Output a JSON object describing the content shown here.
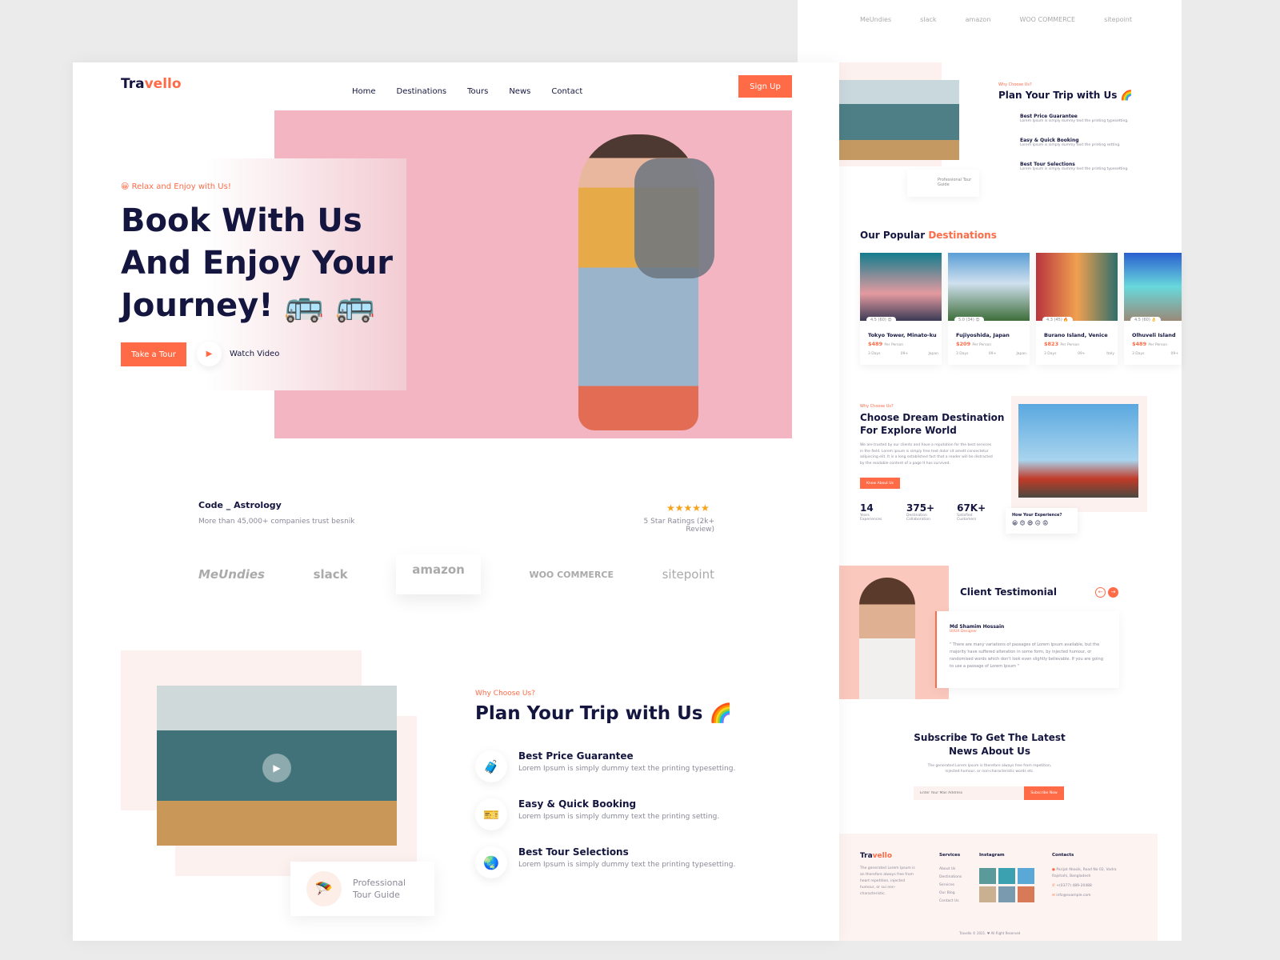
{
  "colors": {
    "accent": "#ff6b47",
    "navy": "#14163f",
    "pink": "#f2b8c2",
    "soft": "#fdf1ef"
  },
  "header": {
    "logo_a": "Tra",
    "logo_b": "vello",
    "nav": [
      "Home",
      "Destinations",
      "Tours",
      "News",
      "Contact"
    ],
    "signup": "Sign Up"
  },
  "hero": {
    "eyebrow": "😀 Relax and Enjoy with Us!",
    "title_l1": "Book With Us",
    "title_l2": "And Enjoy Your",
    "title_l3": "Journey! 🚌 🚌",
    "cta": "Take a Tour",
    "video": "Watch Video"
  },
  "trust": {
    "company": "Code _ Astrology",
    "sub": "More than 45,000+ companies trust besnik",
    "stars": "★★★★★",
    "rating": "5 Star Ratings (2k+ Review)",
    "rating_value": 5
  },
  "brands": [
    "MeUndies",
    "slack",
    "amazon",
    "WOO COMMERCE",
    "sitepoint"
  ],
  "plan": {
    "eyebrow": "Why Choose Us?",
    "title": "Plan Your Trip with Us 🌈",
    "guide": "Professional Tour Guide",
    "features": [
      {
        "icon": "luggage-icon",
        "glyph": "🧳",
        "title": "Best Price Guarantee",
        "desc": "Lorem Ipsum is simply dummy text the printing typesetting."
      },
      {
        "icon": "ticket-icon",
        "glyph": "🎫",
        "title": "Easy & Quick Booking",
        "desc": "Lorem Ipsum is simply dummy text the printing setting."
      },
      {
        "icon": "globe-icon",
        "glyph": "🌏",
        "title": "Best Tour Selections",
        "desc": "Lorem Ipsum is simply dummy text the printing typesetting."
      }
    ]
  },
  "popular": {
    "title_a": "Our Popular ",
    "title_b": "Destinations",
    "cards": [
      {
        "name": "Tokyo Tower, Minato-ku",
        "price": "$489",
        "per": "Per Person",
        "rating": "4.5 (60) 😍",
        "days": "3 Days",
        "people": "09+",
        "place": "Japan"
      },
      {
        "name": "Fujiyoshida, Japan",
        "price": "$209",
        "per": "Per Person",
        "rating": "5.0 (34) 😍",
        "days": "3 Days",
        "people": "09+",
        "place": "Japan"
      },
      {
        "name": "Burano Island, Venice",
        "price": "$823",
        "per": "Per Person",
        "rating": "4.3 (45) 🔥",
        "days": "3 Days",
        "people": "09+",
        "place": "Italy"
      },
      {
        "name": "Olhuveli Island",
        "price": "$489",
        "per": "Per Person",
        "rating": "4.5 (60) 👌",
        "days": "3 Days",
        "people": "09+",
        "place": ""
      }
    ]
  },
  "dream": {
    "eyebrow": "Why Choose Us?",
    "title_l1": "Choose Dream Destination",
    "title_l2": "For Explore World",
    "body": "We are trusted by our clients and have a reputation for the best services in the field. Lorem ipsum is simply free text dolor sit amett consectetur adipiscing elit. It is a long established fact that a reader will be distracted by the readable content of a page It has survived.",
    "cta": "Know About Us",
    "stats": [
      {
        "v": "14",
        "l": "Years Experiences"
      },
      {
        "v": "375+",
        "l": "Destination Collaboration"
      },
      {
        "v": "67K+",
        "l": "Satisfied Customers"
      }
    ],
    "experience": "How Your Experience?",
    "emojis": "😀 😍 😄 😐 😡"
  },
  "testimonial": {
    "title": "Client Testimonial",
    "name": "Md Shamim Hossain",
    "role": "UI/UX Designer",
    "quote": "\" There are many variations of passages of Lorem Ipsum available, but the majority have suffered alteration in some form, by injected humour, or randomised words which don't look even slightly believable. If you are going to use a passage of Lorem Ipsum \""
  },
  "subscribe": {
    "title_l1": "Subscribe To Get The Latest",
    "title_l2": "News About Us",
    "body": "The generated Lorem Ipsum is therefore always free from repetition, injected humour, or non-characteristic words etc.",
    "placeholder": "Enter Your Mail Address",
    "button": "Subscribe Now"
  },
  "footer": {
    "about": "The generated Lorem Ipsum is an therefore always free from heart repetition, injected humour, or sui non-characteristic.",
    "services_title": "Services",
    "services": [
      "About Us",
      "Destinations",
      "Services",
      "Our Blog",
      "Contact Us"
    ],
    "instagram_title": "Instagram",
    "contacts_title": "Contacts",
    "address": "Parijat Abasik, Road No 02, Vadra Rajshahi, Bangladesh",
    "phone": "+(0377) 489-20488",
    "email": "info@example.com",
    "copyright": "Travello © 2021. ♥ All Right Reserved"
  }
}
